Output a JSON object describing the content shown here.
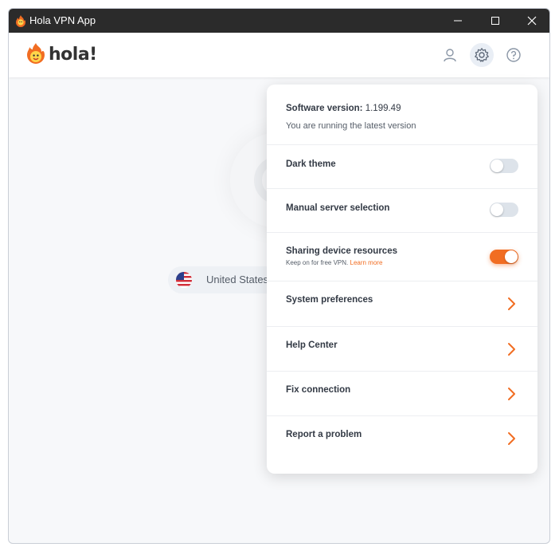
{
  "window": {
    "title": "Hola VPN App"
  },
  "header": {
    "logo_text": "hola!"
  },
  "main": {
    "country": "United States"
  },
  "settings": {
    "version_label": "Software version:",
    "version_value": "1.199.49",
    "version_status": "You are running the latest version",
    "dark_theme": {
      "label": "Dark theme",
      "enabled": false
    },
    "manual_server": {
      "label": "Manual server selection",
      "enabled": false
    },
    "sharing": {
      "label": "Sharing device resources",
      "note": "Keep on for free VPN.",
      "link": "Learn more",
      "enabled": true
    },
    "links": [
      {
        "label": "System preferences"
      },
      {
        "label": "Help Center"
      },
      {
        "label": "Fix connection"
      },
      {
        "label": "Report a problem"
      }
    ]
  },
  "colors": {
    "accent": "#f16d22",
    "titlebar": "#2b2b2b"
  },
  "icons": [
    "hola-flame-icon",
    "user-icon",
    "gear-icon",
    "help-icon",
    "us-flag-icon",
    "chevron-right-icon"
  ]
}
